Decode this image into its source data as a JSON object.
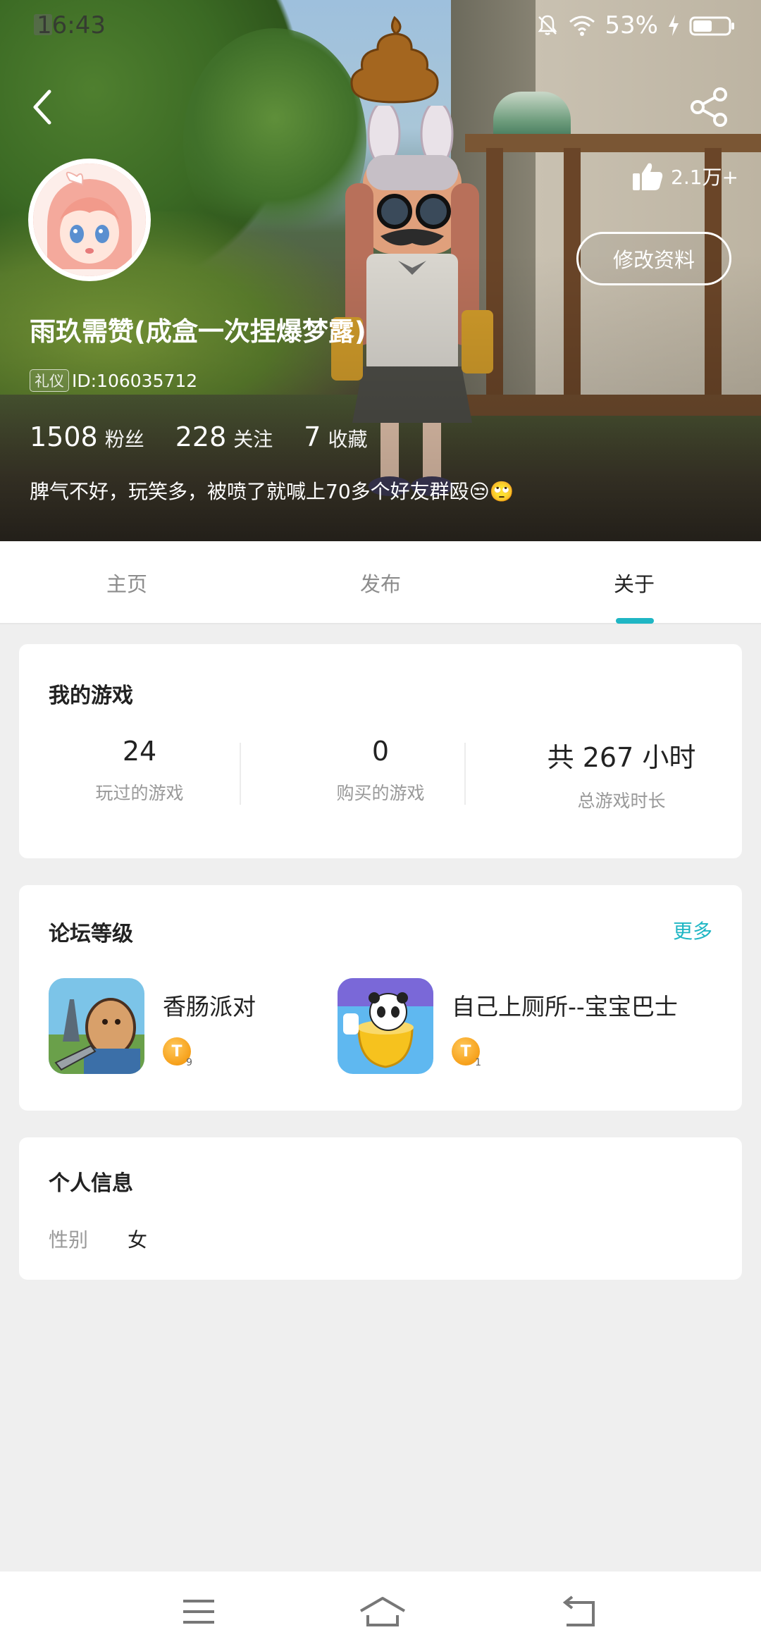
{
  "status_bar": {
    "time": "16:43",
    "battery_pct": "53%"
  },
  "header": {
    "likes": "2.1万+",
    "edit_label": "修改资料",
    "nickname": "雨玖需赞(成盒一次捏爆梦露)",
    "badge": "礼仪",
    "id": "ID:106035712",
    "stats": [
      {
        "value": "1508",
        "label": "粉丝"
      },
      {
        "value": "228",
        "label": "关注"
      },
      {
        "value": "7",
        "label": "收藏"
      }
    ],
    "bio": "脾气不好，玩笑多，被喷了就喊上70多个好友群殴😒🙄"
  },
  "tabs": [
    {
      "label": "主页"
    },
    {
      "label": "发布"
    },
    {
      "label": "关于"
    }
  ],
  "my_games": {
    "title": "我的游戏",
    "stats": [
      {
        "value": "24",
        "label": "玩过的游戏"
      },
      {
        "value": "0",
        "label": "购买的游戏"
      },
      {
        "value": "共 267 小时",
        "label": "总游戏时长"
      }
    ]
  },
  "forum": {
    "title": "论坛等级",
    "more": "更多",
    "items": [
      {
        "name": "香肠派对",
        "level": "T",
        "level_num": "9"
      },
      {
        "name": "自己上厕所--宝宝巴士",
        "level": "T",
        "level_num": "1"
      }
    ]
  },
  "personal": {
    "title": "个人信息",
    "gender_label": "性别",
    "gender_value": "女"
  },
  "colors": {
    "accent": "#1fb6c4"
  }
}
